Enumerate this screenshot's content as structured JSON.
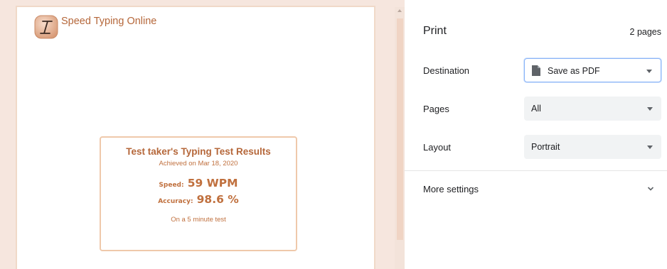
{
  "preview": {
    "site_title": "Speed Typing Online",
    "logo_icon": "italic-i-logo-icon",
    "results": {
      "heading": "Test taker's Typing Test Results",
      "date_text": "Achieved on Mar 18, 2020",
      "speed_label": "Speed:",
      "speed_value": "59 WPM",
      "accuracy_label": "Accuracy:",
      "accuracy_value": "98.6 %",
      "test_length": "On a 5 minute test"
    }
  },
  "print_panel": {
    "title": "Print",
    "page_count": "2 pages",
    "destination": {
      "label": "Destination",
      "value": "Save as PDF",
      "icon": "document-icon"
    },
    "pages": {
      "label": "Pages",
      "value": "All"
    },
    "layout": {
      "label": "Layout",
      "value": "Portrait"
    },
    "more_settings": {
      "label": "More settings",
      "icon": "chevron-down-icon"
    }
  },
  "colors": {
    "brand": "#b5673a",
    "preview_background": "#f6e6de",
    "card_border": "#efc9ab",
    "focus_ring": "#8ab4f8"
  }
}
